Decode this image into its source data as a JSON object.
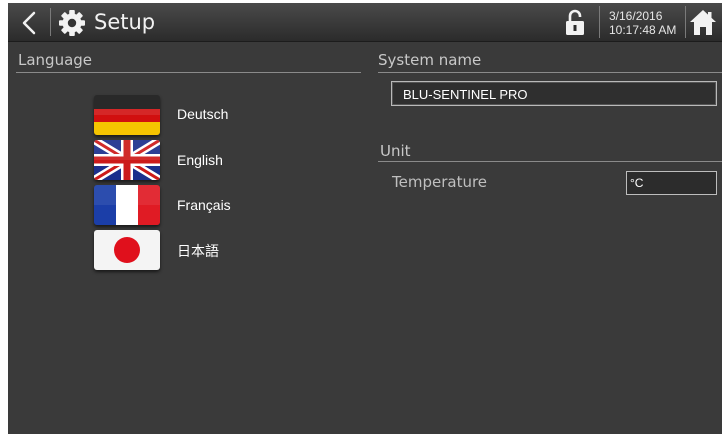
{
  "header": {
    "title": "Setup",
    "date": "3/16/2016",
    "time": "10:17:48 AM"
  },
  "language": {
    "header": "Language",
    "items": [
      {
        "label": "Deutsch",
        "flag": "german-flag"
      },
      {
        "label": "English",
        "flag": "uk-flag"
      },
      {
        "label": "Français",
        "flag": "french-flag"
      },
      {
        "label": "日本語",
        "flag": "japanese-flag"
      }
    ]
  },
  "system_name": {
    "header": "System name",
    "value": "BLU-SENTINEL PRO"
  },
  "unit": {
    "header": "Unit",
    "temperature_label": "Temperature",
    "temperature_value": "°C"
  },
  "colors": {
    "background": "#3a3a3a",
    "topbar": "#2b2b2b",
    "text": "#ffffff",
    "header_text": "#c8c8c8"
  }
}
